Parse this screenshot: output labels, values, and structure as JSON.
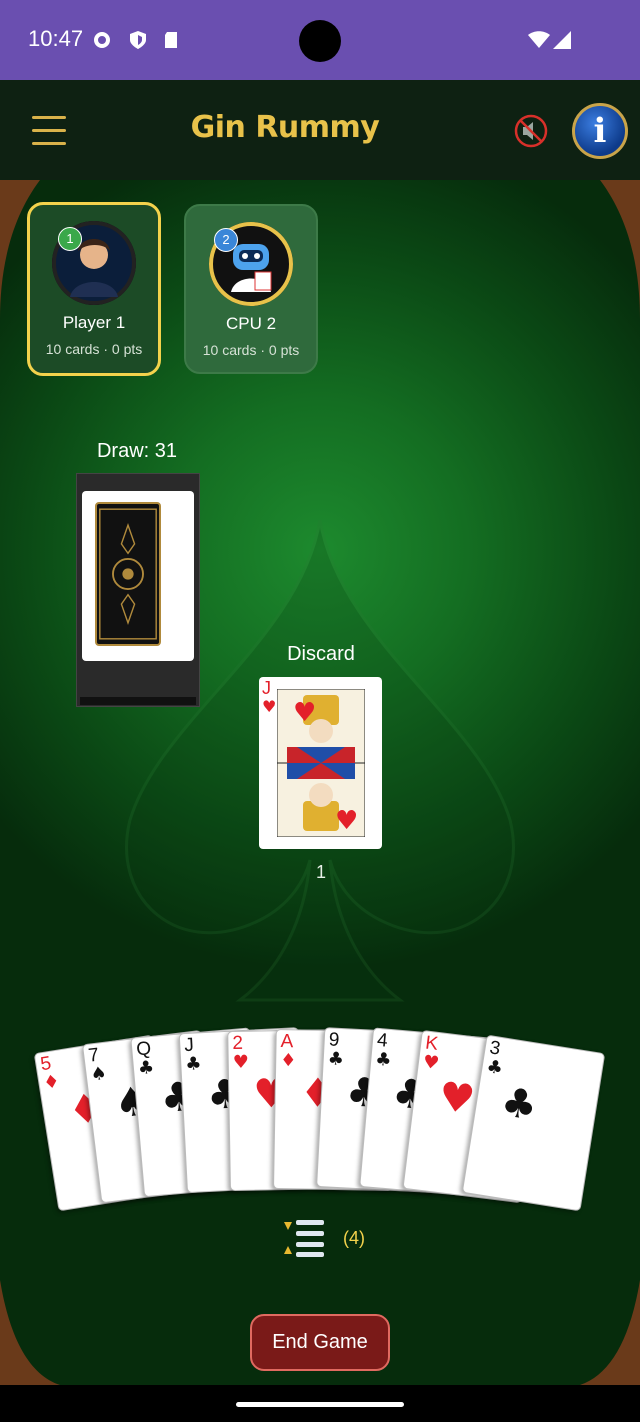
{
  "status_bar": {
    "time": "10:47",
    "icons": [
      "settings-icon",
      "shield-icon",
      "sd-card-icon",
      "wifi-icon",
      "signal-icon"
    ]
  },
  "header": {
    "title": "Gin Rummy",
    "menu_icon": "hamburger-menu-icon",
    "sound_icon": "sound-muted-icon",
    "info_icon_label": "i"
  },
  "players": [
    {
      "badge": "1",
      "name": "Player 1",
      "stats": "10 cards · 0 pts",
      "active": true,
      "badge_color": "#3aa84a"
    },
    {
      "badge": "2",
      "name": "CPU 2",
      "stats": "10 cards · 0 pts",
      "active": false,
      "badge_color": "#3a86d8"
    }
  ],
  "draw_pile": {
    "label": "Draw: 31"
  },
  "discard_pile": {
    "label": "Discard",
    "top_card": {
      "rank": "J",
      "suit": "♥"
    },
    "count": "1"
  },
  "hand": [
    {
      "rank": "5",
      "suit": "♦",
      "color": "red"
    },
    {
      "rank": "7",
      "suit": "♠",
      "color": "black"
    },
    {
      "rank": "Q",
      "suit": "♣",
      "color": "black"
    },
    {
      "rank": "J",
      "suit": "♣",
      "color": "black"
    },
    {
      "rank": "2",
      "suit": "♥",
      "color": "red"
    },
    {
      "rank": "A",
      "suit": "♦",
      "color": "red"
    },
    {
      "rank": "9",
      "suit": "♣",
      "color": "black"
    },
    {
      "rank": "4",
      "suit": "♣",
      "color": "black"
    },
    {
      "rank": "K",
      "suit": "♥",
      "color": "red"
    },
    {
      "rank": "3",
      "suit": "♣",
      "color": "black"
    }
  ],
  "hand_controls": {
    "sort_icon": "sort-icon",
    "sort_count": "(4)"
  },
  "end_game_label": "End Game",
  "colors": {
    "accent": "#f3d24c",
    "felt": "#146e22",
    "end_game": "#7a1a18"
  }
}
